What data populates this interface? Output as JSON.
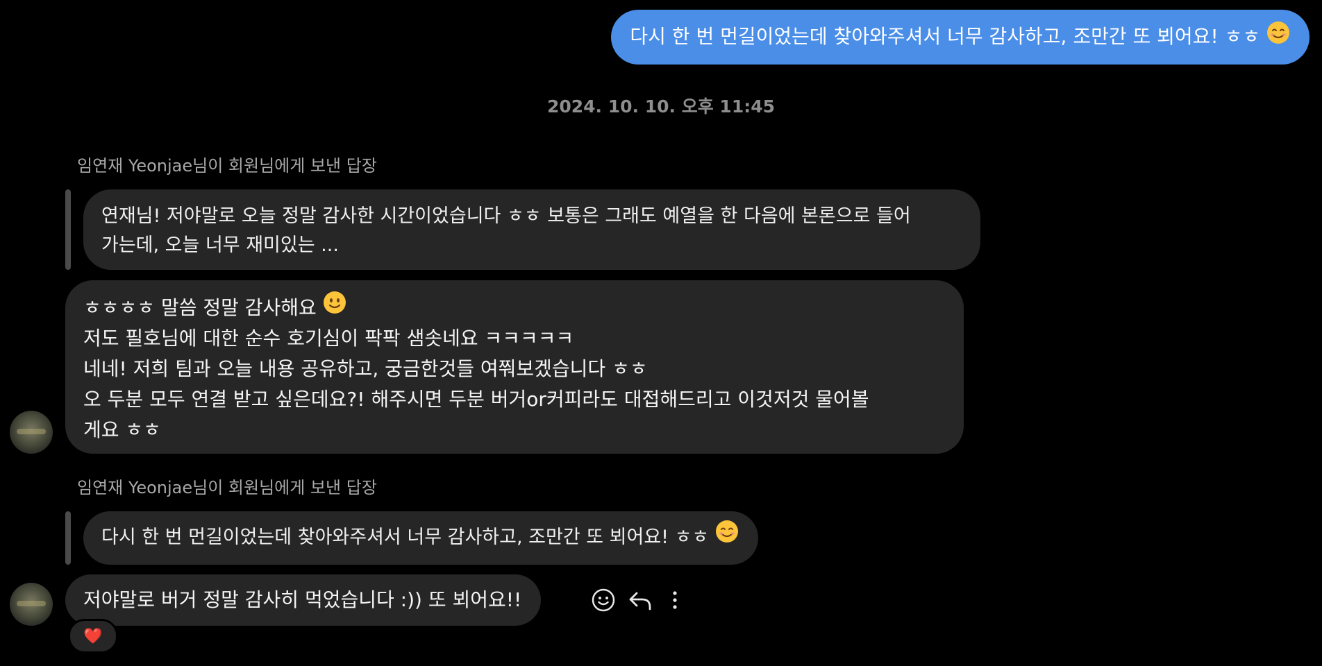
{
  "outgoing_message": {
    "text": "다시 한 번 먼길이었는데 찾아와주셔서 너무 감사하고, 조만간 또 뵈어요! ㅎㅎ",
    "emoji": "smiling-face-icon"
  },
  "timestamp": "2024. 10. 10. 오후 11:45",
  "reply_label": "임연재 Yeonjae님이 회원님에게 보낸 답장",
  "thread": [
    {
      "quoted": {
        "lines": [
          "연재님! 저야말로 오늘 정말 감사한 시간이었습니다 ㅎㅎ 보통은 그래도 예열을 한 다음에 본론으로 들어",
          "가는데, 오늘 너무 재미있는 ..."
        ]
      },
      "message": {
        "lines": [
          "ㅎㅎㅎㅎ 말씀 정말 감사해요",
          "저도 필호님에 대한 순수 호기심이 팍팍 샘솟네요 ㅋㅋㅋㅋㅋ",
          "네네! 저희 팀과 오늘 내용 공유하고, 궁금한것들 여쭤보겠습니다 ㅎㅎ",
          "오 두분 모두 연결 받고 싶은데요?! 해주시면 두분 버거or커피라도 대접해드리고 이것저것 물어볼",
          "게요 ㅎㅎ"
        ],
        "emoji": "slightly-smiling-face-icon"
      }
    },
    {
      "quoted": {
        "lines": [
          "다시 한 번 먼길이었는데 찾아와주셔서 너무 감사하고, 조만간 또 뵈어요! ㅎㅎ"
        ],
        "emoji": "smiling-face-icon"
      },
      "message": {
        "lines": [
          "저야말로 버거 정말 감사히 먹었습니다 :)) 또 뵈어요!!"
        ],
        "reaction": "❤️"
      }
    }
  ],
  "actions": [
    "react-icon",
    "reply-icon",
    "more-options-icon"
  ],
  "colors": {
    "background": "#000000",
    "outgoing_bubble": "#4a8ee8",
    "incoming_bubble": "#262626",
    "quote_bar": "#4a4a4a",
    "meta_text": "#8e8e8e"
  }
}
